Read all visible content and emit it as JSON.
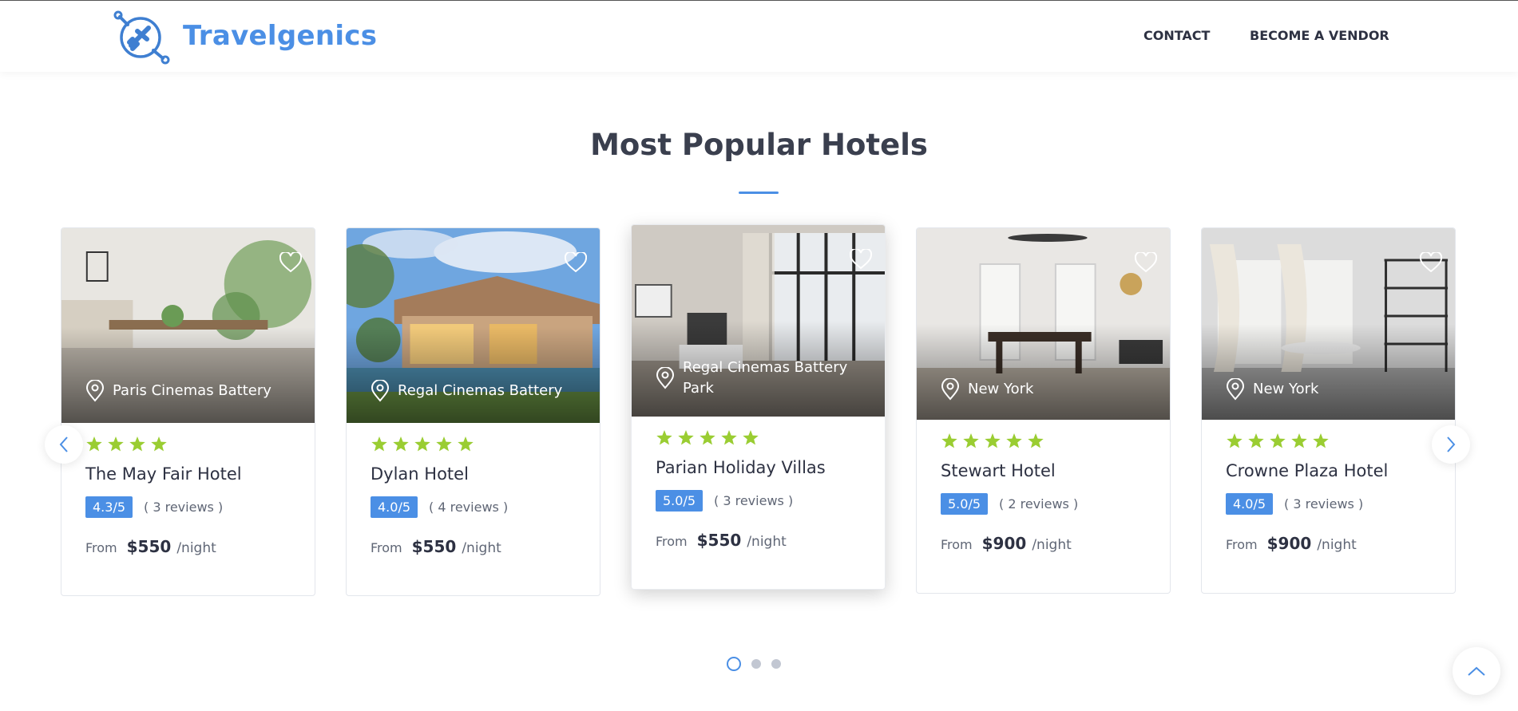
{
  "header": {
    "brand": "Travelgenics",
    "nav": [
      {
        "label": "CONTACT"
      },
      {
        "label": "BECOME A VENDOR"
      }
    ]
  },
  "section": {
    "title": "Most Popular Hotels"
  },
  "colors": {
    "accent": "#4b8fe5",
    "star": "#9acd32",
    "text": "#2d3142"
  },
  "hotels": [
    {
      "location": "Paris Cinemas Battery",
      "stars": 4,
      "name": "The May Fair Hotel",
      "rating": "4.3/5",
      "reviews": "( 3 reviews )",
      "from": "From",
      "price": "$550",
      "unit": "/night"
    },
    {
      "location": "Regal Cinemas Battery",
      "stars": 5,
      "name": "Dylan Hotel",
      "rating": "4.0/5",
      "reviews": "( 4 reviews )",
      "from": "From",
      "price": "$550",
      "unit": "/night"
    },
    {
      "location": "Regal Cinemas Battery Park",
      "stars": 5,
      "name": "Parian Holiday Villas",
      "rating": "5.0/5",
      "reviews": "( 3 reviews )",
      "from": "From",
      "price": "$550",
      "unit": "/night"
    },
    {
      "location": "New York",
      "stars": 5,
      "name": "Stewart Hotel",
      "rating": "5.0/5",
      "reviews": "( 2 reviews )",
      "from": "From",
      "price": "$900",
      "unit": "/night"
    },
    {
      "location": "New York",
      "stars": 5,
      "name": "Crowne Plaza Hotel",
      "rating": "4.0/5",
      "reviews": "( 3 reviews )",
      "from": "From",
      "price": "$900",
      "unit": "/night"
    }
  ],
  "carousel": {
    "page_count": 3,
    "active_page": 1
  },
  "icons": {
    "logo": "plane-globe-logo-icon",
    "favorite": "heart-icon",
    "location": "map-pin-icon",
    "rating": "star-icon",
    "prev": "chevron-left-icon",
    "next": "chevron-right-icon",
    "scroll_top": "chevron-up-icon"
  }
}
